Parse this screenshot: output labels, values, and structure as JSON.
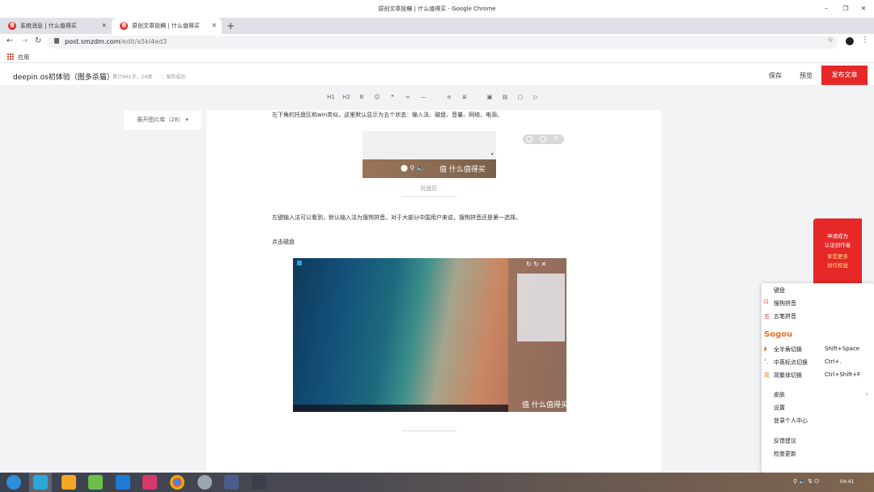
{
  "window": {
    "title": "原创文章投稿 | 什么值得买 - Google Chrome"
  },
  "tabs": [
    {
      "label": "系统消息 | 什么值得买",
      "favicon": "值"
    },
    {
      "label": "原创文章投稿 | 什么值得买",
      "favicon": "值"
    }
  ],
  "address": {
    "domain": "post.smzdm.com",
    "path": "/edit/a5kl4ed3"
  },
  "bookmarks": {
    "apps_label": "应用"
  },
  "editor": {
    "title": "deepin os初体验（图多杀猫）",
    "word_count": "累计961字，24图",
    "save_status": "保存成功",
    "save": "保存",
    "preview": "预览",
    "publish": "发布文章"
  },
  "format_bar": [
    "H1",
    "H2",
    "B",
    "☺",
    "❝",
    "∞",
    "—",
    "≡",
    "≣",
    "▣",
    "▤",
    "▢",
    "▷"
  ],
  "gallery": {
    "label": "展开图片库（28）"
  },
  "doc": {
    "para1": "左下角的托盘区和win类似，这里默认显示为五个状态：输入法、磁盘、音量、网络、电源。",
    "caption1": "托盘区",
    "watermark": "值 什么值得买",
    "para2": "左键输入法可以看到，默认输入法为搜狗拼音。对于大部分中国用户来说，搜狗拼音还是第一选择。",
    "para3": "点击磁盘"
  },
  "promo": {
    "line1": "申请成为",
    "line2": "认证创作者",
    "line3": "享受更多",
    "line4": "创作权益"
  },
  "context_menu": {
    "keyboard": "键盘",
    "sogou_pinyin": "搜狗拼音",
    "wubi": "五笔拼音",
    "brand": "Sogou",
    "fullhalf": {
      "label": "全半角切换",
      "shortcut": "Shift+Space"
    },
    "punct": {
      "label": "中英标点切换",
      "shortcut": "Ctrl+."
    },
    "simptrad": {
      "label": "简繁体切换",
      "shortcut": "Ctrl+Shift+F"
    },
    "skin": "皮肤",
    "settings": "设置",
    "login": "登录个人中心",
    "feedback": "反馈建议",
    "update": "检查更新"
  },
  "taskbar": {
    "clock": "04:41"
  }
}
